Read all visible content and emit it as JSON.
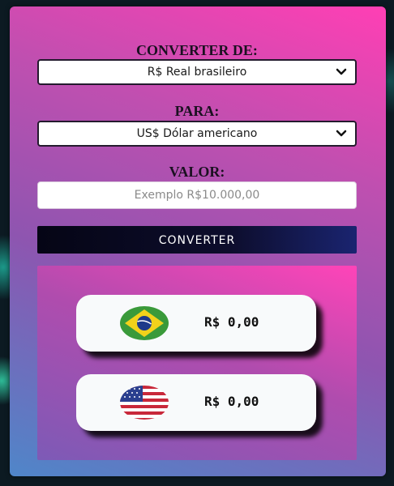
{
  "form": {
    "from_label": "CONVERTER DE:",
    "from_selected": "R$ Real brasileiro",
    "to_label": "PARA:",
    "to_selected": "US$ Dólar americano",
    "value_label": "VALOR:",
    "value_placeholder": "Exemplo R$10.000,00",
    "convert_button": "CONVERTER"
  },
  "results": {
    "items": [
      {
        "flag": "brazil-flag-icon",
        "amount": "R$ 0,00"
      },
      {
        "flag": "usa-flag-icon",
        "amount": "R$ 0,00"
      }
    ]
  },
  "colors": {
    "card_gradient_top": "#ff3fb4",
    "card_gradient_bottom": "#4f86c9",
    "button_dark": "#0d0d2c"
  }
}
